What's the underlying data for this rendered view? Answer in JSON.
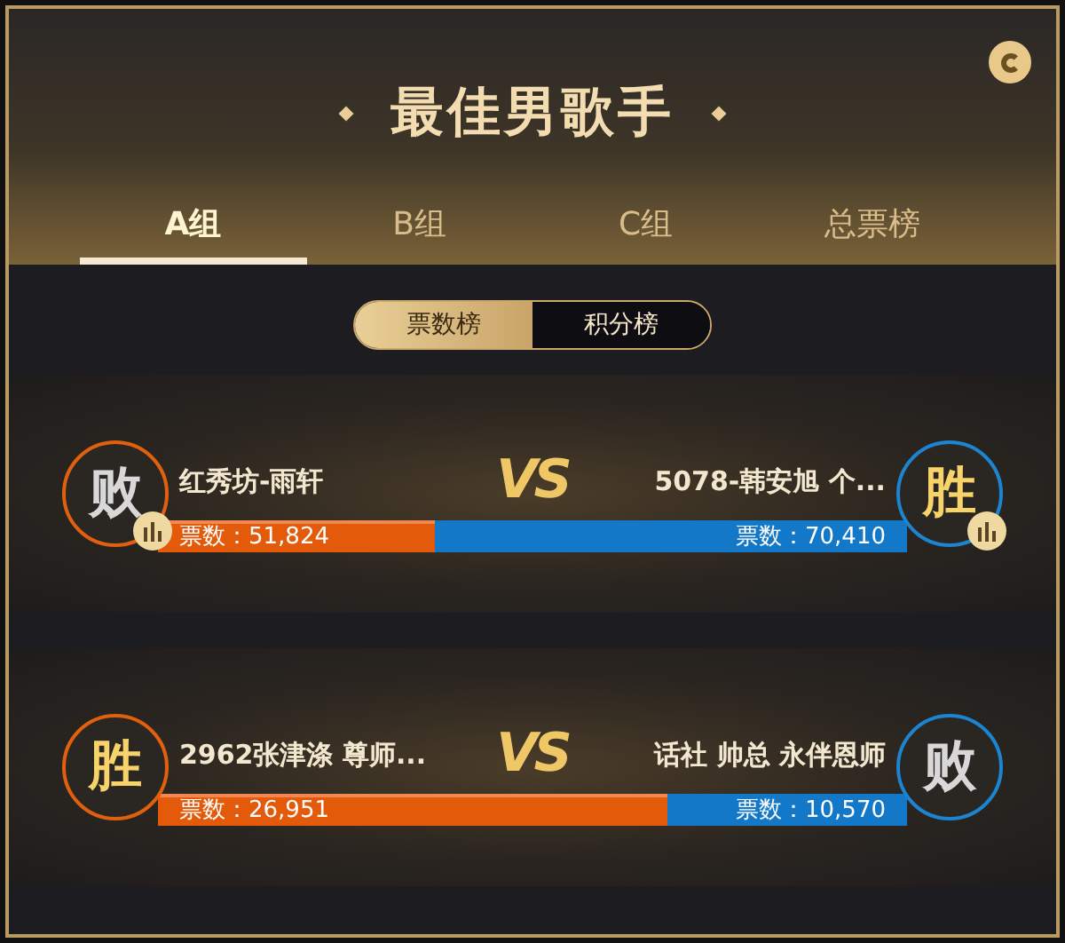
{
  "title": "最佳男歌手",
  "tabs": [
    {
      "label": "A组",
      "selected": true
    },
    {
      "label": "B组",
      "selected": false
    },
    {
      "label": "C组",
      "selected": false
    },
    {
      "label": "总票榜",
      "selected": false
    }
  ],
  "toggle": [
    {
      "label": "票数榜",
      "selected": true
    },
    {
      "label": "积分榜",
      "selected": false
    }
  ],
  "matches": [
    {
      "vs": "VS",
      "level": 0.37,
      "left": {
        "name": "红秀坊-雨轩",
        "result": "败",
        "win": false,
        "stats": true,
        "votes": "票数：51,824"
      },
      "right": {
        "name": "5078-韩安旭 个...",
        "result": "胜",
        "win": true,
        "stats": true,
        "votes": "票数：70,410"
      }
    },
    {
      "vs": "VS",
      "level": 0.68,
      "left": {
        "name": "2962张津涤 尊师...",
        "result": "胜",
        "win": true,
        "stats": false,
        "votes": "票数：26,951"
      },
      "right": {
        "name": "话社 帅总 永伴恩师",
        "result": "败",
        "win": false,
        "stats": false,
        "votes": "票数：10,570"
      }
    }
  ]
}
